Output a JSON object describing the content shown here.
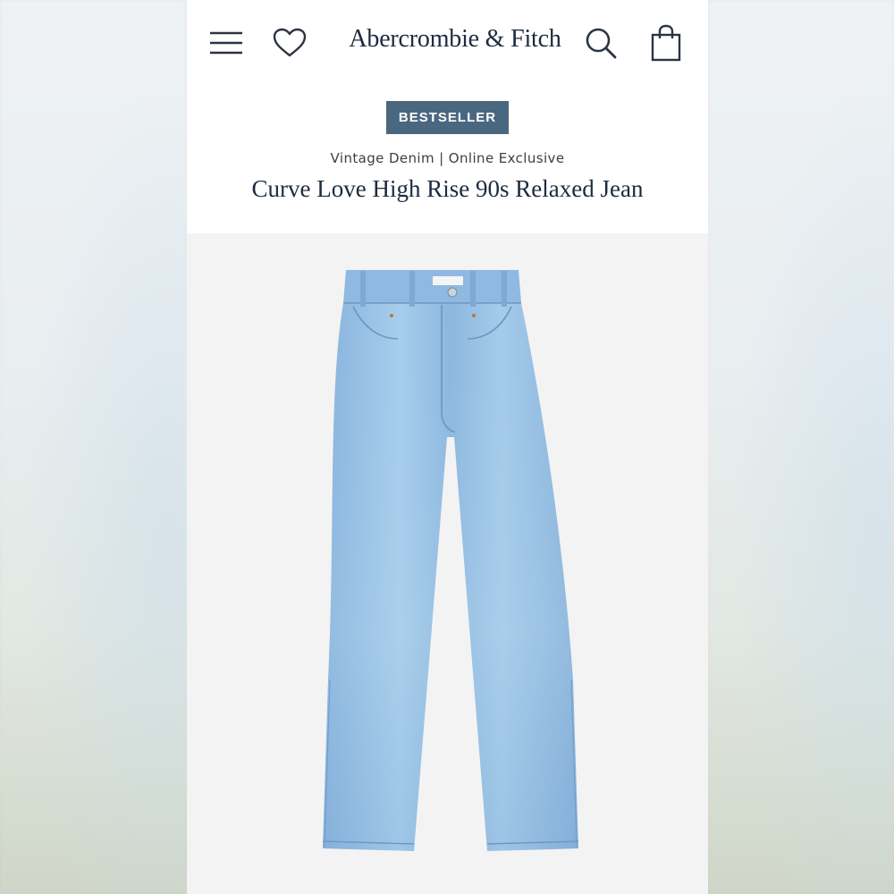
{
  "header": {
    "brand": "Abercrombie & Fitch",
    "icons": [
      "menu-icon",
      "heart-icon",
      "search-icon",
      "shopping-bag-icon"
    ]
  },
  "product": {
    "badge": "BESTSELLER",
    "subline": "Vintage Denim | Online Exclusive",
    "title": "Curve Love High Rise 90s Relaxed Jean"
  },
  "colors": {
    "navy": "#1d2b3e",
    "badge_bg": "#4a6780",
    "denim": "#9cc4e4",
    "denim_dark": "#7fabd3"
  }
}
